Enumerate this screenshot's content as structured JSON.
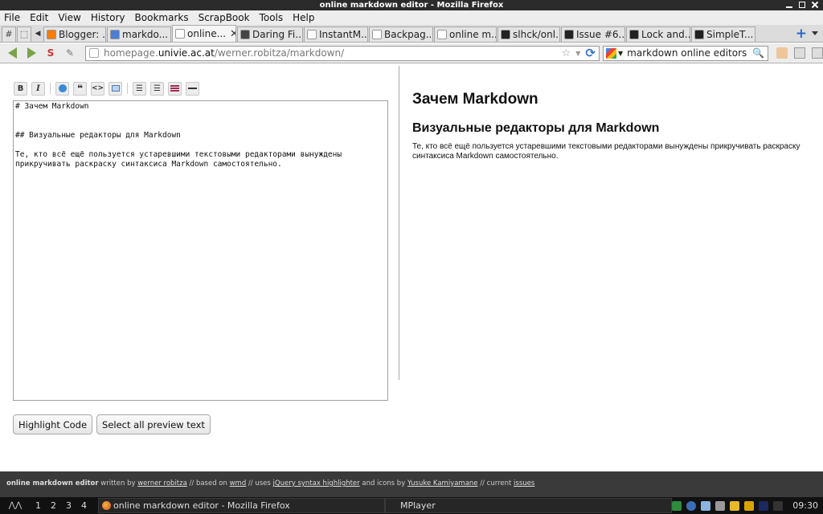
{
  "window": {
    "title": "online markdown editor - Mozilla Firefox"
  },
  "menu": [
    "File",
    "Edit",
    "View",
    "History",
    "Bookmarks",
    "ScrapBook",
    "Tools",
    "Help"
  ],
  "tabs": [
    {
      "label": "Blogger: ...",
      "icon": "blogger-icon",
      "color": "#f57d00"
    },
    {
      "label": "markdo...",
      "icon": "google-icon",
      "color": "#4a7fd6"
    },
    {
      "label": "online...",
      "icon": "page-icon",
      "color": "#ffffff",
      "active": true
    },
    {
      "label": "Daring Fi...",
      "icon": "daringfireball-icon",
      "color": "#444444"
    },
    {
      "label": "InstantM...",
      "icon": "page-icon",
      "color": "#ffffff"
    },
    {
      "label": "Backpag...",
      "icon": "page-icon",
      "color": "#ffffff"
    },
    {
      "label": "online m...",
      "icon": "page-icon",
      "color": "#ffffff"
    },
    {
      "label": "slhck/onl...",
      "icon": "github-icon",
      "color": "#222222"
    },
    {
      "label": "Issue #6...",
      "icon": "github-icon",
      "color": "#222222"
    },
    {
      "label": "Lock and...",
      "icon": "h-icon",
      "color": "#222222"
    },
    {
      "label": "SimpleT...",
      "icon": "simplenote-icon",
      "color": "#222222"
    }
  ],
  "nav": {
    "url_prefix": "homepage.",
    "url_domain": "univie.ac.at",
    "url_path": "/werner.robitza/markdown/",
    "search_value": "markdown online editors"
  },
  "editor": {
    "toolbar": [
      "B",
      "I",
      "link",
      "quote",
      "code",
      "image",
      "ol",
      "ul",
      "heading",
      "hr"
    ],
    "source": "# Зачем Markdown\n\n\n## Визуальные редакторы для Markdown\n\nТе, кто всё ещё пользуется устаревшими текстовыми редакторами вынуждены\nприкручивать раскраску синтаксиса Markdown самостоятельно.",
    "highlight_button": "Highlight Code",
    "select_button": "Select all preview text"
  },
  "preview": {
    "h1": "Зачем Markdown",
    "h2": "Визуальные редакторы для Markdown",
    "p": "Те, кто всё ещё пользуется устаревшими текстовыми редакторами вынуждены прикручивать раскраску синтаксиса Markdown самостоятельно."
  },
  "footer": {
    "name": "online markdown editor",
    "t1": " written by ",
    "author": "werner robitza",
    "t2": " // based on ",
    "wmd": "wmd",
    "t3": " // uses ",
    "jquery": "jQuery syntax highlighter",
    "t4": " and icons by ",
    "icons": "Yusuke Kamiyamane",
    "t5": " // current ",
    "issues": "issues"
  },
  "taskbar": {
    "desktops": [
      "1",
      "2",
      "3",
      "4"
    ],
    "task1": "online markdown editor - Mozilla Firefox",
    "task2": "MPlayer",
    "clock": "09:30"
  }
}
